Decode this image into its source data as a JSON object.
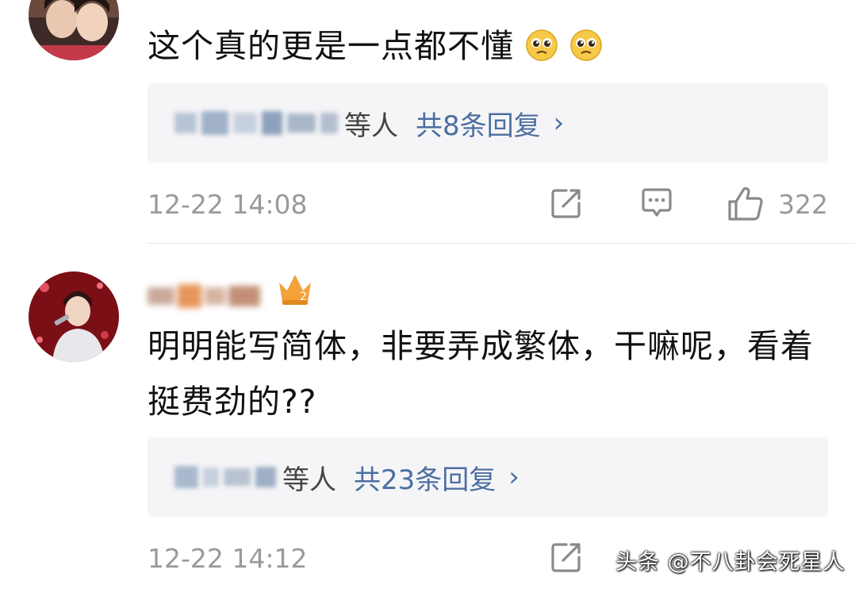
{
  "comments": [
    {
      "text": "这个真的更是一点都不懂",
      "emoji": [
        "pleading-face",
        "pleading-face"
      ],
      "reply_suffix": "等人",
      "reply_count": "共8条回复",
      "reply_chevron": "›",
      "time": "12-22 14:08",
      "likes": "322"
    },
    {
      "text": "明明能写简体，非要弄成繁体，干嘛呢，看着挺费劲的??",
      "reply_suffix": "等人",
      "reply_count": "共23条回复",
      "reply_chevron": "›",
      "time": "12-22 14:12"
    }
  ],
  "watermark": "头条 @不八卦会死星人",
  "colors": {
    "link": "#4c6fa1",
    "meta": "#9a9a9a",
    "reply_bg": "#f5f5f7",
    "text": "#111111"
  }
}
